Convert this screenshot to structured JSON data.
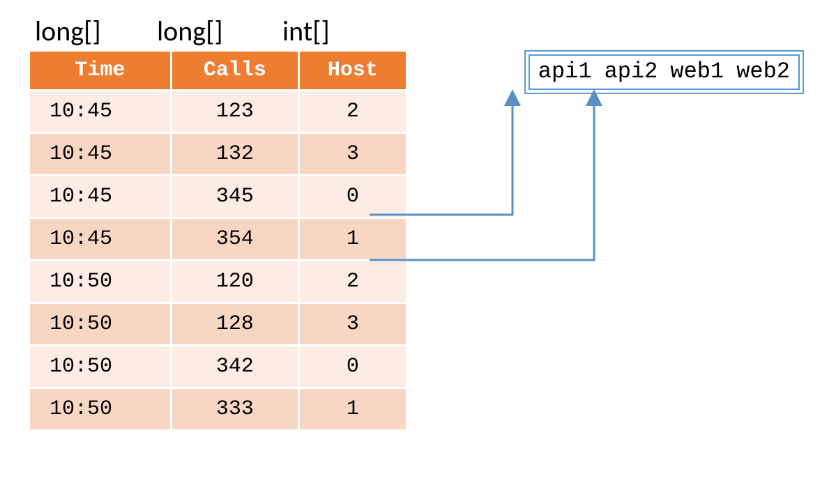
{
  "type_labels": [
    "long[]",
    "long[]",
    "int[]"
  ],
  "columns": [
    "Time",
    "Calls",
    "Host"
  ],
  "rows": [
    {
      "time": "10:45",
      "calls": "123",
      "host": "2"
    },
    {
      "time": "10:45",
      "calls": "132",
      "host": "3"
    },
    {
      "time": "10:45",
      "calls": "345",
      "host": "0"
    },
    {
      "time": "10:45",
      "calls": "354",
      "host": "1"
    },
    {
      "time": "10:50",
      "calls": "120",
      "host": "2"
    },
    {
      "time": "10:50",
      "calls": "128",
      "host": "3"
    },
    {
      "time": "10:50",
      "calls": "342",
      "host": "0"
    },
    {
      "time": "10:50",
      "calls": "333",
      "host": "1"
    }
  ],
  "lookup": [
    "api1",
    "api2",
    "web1",
    "web2"
  ],
  "arrow_sources": [
    {
      "row_index": 2,
      "target_lookup_index": 0
    },
    {
      "row_index": 3,
      "target_lookup_index": 1
    }
  ]
}
